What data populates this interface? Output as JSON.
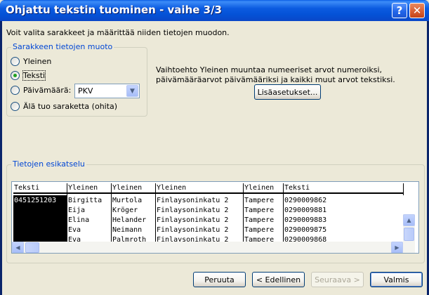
{
  "window": {
    "title": "Ohjattu tekstin tuominen - vaihe 3/3",
    "help": "?",
    "close": "✕"
  },
  "instruction": "Voit valita sarakkeet ja määrittää niiden tietojen muodon.",
  "format_group": {
    "label": "Sarakkeen tietojen muoto",
    "options": [
      {
        "label": "Yleinen",
        "checked": false
      },
      {
        "label": "Teksti",
        "checked": true
      },
      {
        "label": "Päivämäärä:",
        "checked": false
      },
      {
        "label": "Älä tuo saraketta (ohita)",
        "checked": false
      }
    ],
    "date_format": "PKV"
  },
  "description": "Vaihtoehto Yleinen muuntaa numeeriset arvot numeroiksi, päivämääräarvot päivämääriksi ja kaikki muut arvot tekstiksi.",
  "advanced_button": "Lisäasetukset...",
  "preview": {
    "label": "Tietojen esikatselu",
    "headers": [
      "Teksti",
      "Yleinen",
      "Yleinen",
      "Yleinen",
      "Yleinen",
      "Teksti"
    ],
    "rows": [
      [
        "0451251203",
        "Birgitta",
        "Murtola",
        "Finlaysoninkatu 2",
        "Tampere",
        "0290009862"
      ],
      [
        "",
        "Eija",
        "Kröger",
        "Finlaysoninkatu 2",
        "Tampere",
        "0290009881"
      ],
      [
        "",
        "Elina",
        "Helander",
        "Finlaysoninkatu 2",
        "Tampere",
        "0290009883"
      ],
      [
        "",
        "Eva",
        "Neimann",
        "Finlaysoninkatu 2",
        "Tampere",
        "0290009875"
      ],
      [
        "",
        "Eva",
        "Palmroth",
        "Finlaysoninkatu 2",
        "Tampere",
        "0290009868"
      ]
    ]
  },
  "buttons": {
    "cancel": "Peruuta",
    "back": "< Edellinen",
    "next": "Seuraava >",
    "finish": "Valmis"
  },
  "colors": {
    "title_bar": "#0a5fe5",
    "group_label": "#0046d5",
    "close": "#d65b30"
  }
}
